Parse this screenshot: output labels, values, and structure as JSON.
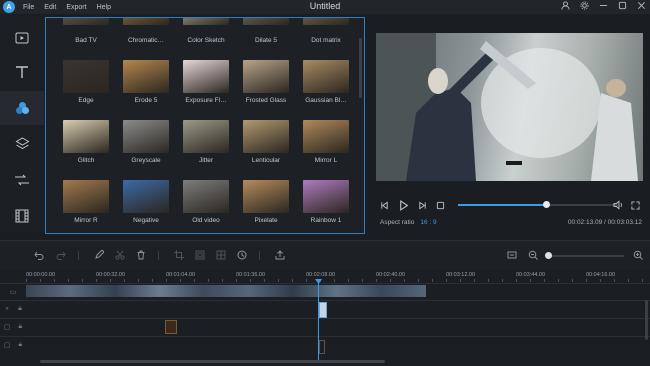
{
  "window": {
    "title": "Untitled",
    "logo_glyph": "A",
    "controls": [
      "user-icon",
      "gear-icon",
      "minimize-icon",
      "maximize-icon",
      "close-icon"
    ]
  },
  "menu": [
    "File",
    "Edit",
    "Export",
    "Help"
  ],
  "rail": {
    "items": [
      {
        "icon": "media-icon"
      },
      {
        "icon": "text-icon"
      },
      {
        "icon": "filters-icon",
        "active": true
      },
      {
        "icon": "overlay-icon"
      },
      {
        "icon": "transition-icon"
      },
      {
        "icon": "film-icon"
      }
    ]
  },
  "effects": [
    {
      "label": "Bad TV",
      "color": "#7f7a72"
    },
    {
      "label": "Chromatic…",
      "color": "#a88c5a"
    },
    {
      "label": "Color Sketch",
      "color": "#d9d1c2"
    },
    {
      "label": "Dilate 5",
      "color": "#8f8a80"
    },
    {
      "label": "Dot matrix",
      "color": "#9a8a70"
    },
    {
      "label": "Edge",
      "color": "#3a3430"
    },
    {
      "label": "Erode 5",
      "color": "#b5874e"
    },
    {
      "label": "Exposure Fl…",
      "color": "#e6d8d8"
    },
    {
      "label": "Frosted Glass",
      "color": "#b8a48a"
    },
    {
      "label": "Gaussian Bl…",
      "color": "#a98b62"
    },
    {
      "label": "Glitch",
      "color": "#d7cdb0"
    },
    {
      "label": "Greyscale",
      "color": "#8c8c8c"
    },
    {
      "label": "Jitter",
      "color": "#9b9a8a"
    },
    {
      "label": "Lenticular",
      "color": "#b39a70"
    },
    {
      "label": "Mirror L",
      "color": "#b08a5a"
    },
    {
      "label": "Mirror R",
      "color": "#a27a4e"
    },
    {
      "label": "Negative",
      "color": "#3b6aa6"
    },
    {
      "label": "Old video",
      "color": "#7d7d7d"
    },
    {
      "label": "Pixelate",
      "color": "#b58c5c"
    },
    {
      "label": "Rainbow 1",
      "color": "#b07bc0"
    }
  ],
  "player": {
    "progress": 0.55,
    "aspect_label": "Aspect ratio",
    "aspect_value": "16 : 9",
    "time": "00:02:13.09 / 00:03:03.12"
  },
  "timeline": {
    "ticks": [
      "00:00:00.00",
      "00:00:32.00",
      "00:01:04.00",
      "00:01:36.00",
      "00:02:08.00",
      "00:02:40.00",
      "00:03:12.00",
      "00:03:44.00",
      "00:04:16.00"
    ]
  },
  "colors": {
    "accent": "#3e9be3",
    "panel_border": "#2d7fbf"
  }
}
